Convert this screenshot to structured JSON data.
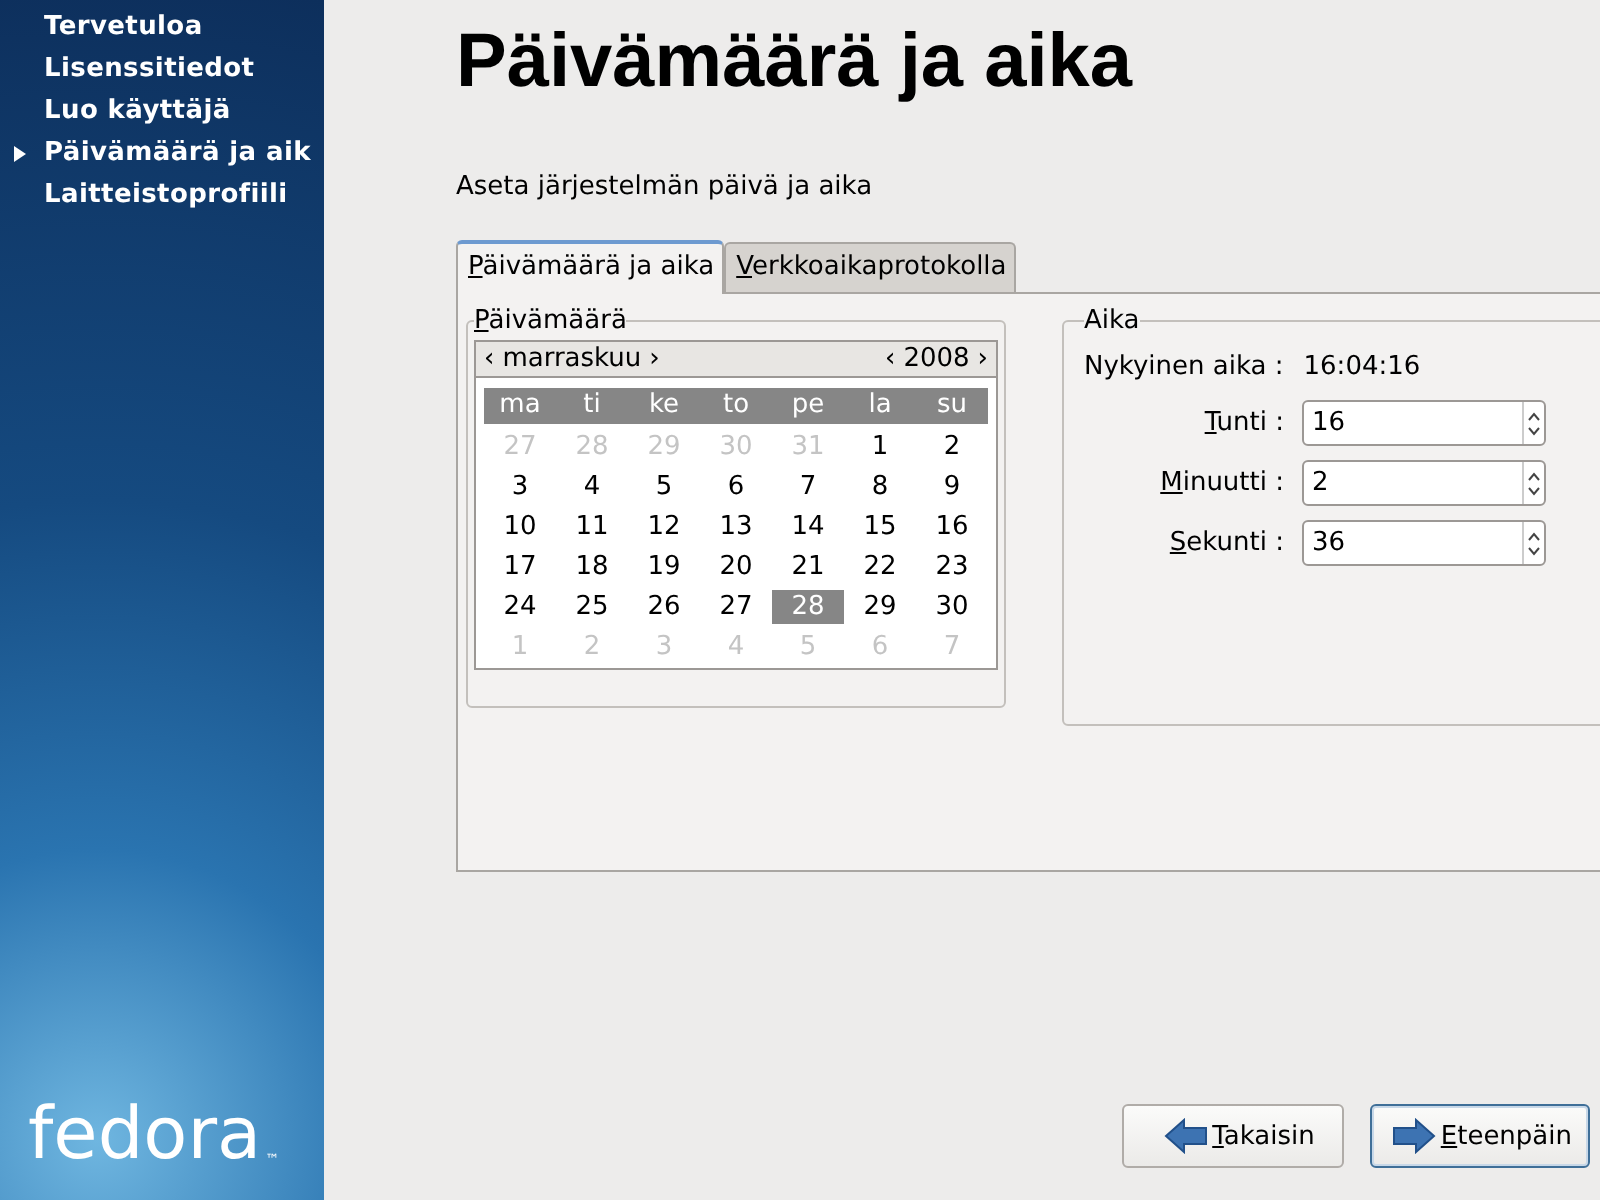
{
  "sidebar": {
    "items": [
      {
        "label": "Tervetuloa",
        "selected": false
      },
      {
        "label": "Lisenssitiedot",
        "selected": false
      },
      {
        "label": "Luo käyttäjä",
        "selected": false
      },
      {
        "label": "Päivämäärä ja aik",
        "selected": true
      },
      {
        "label": "Laitteistoprofiili",
        "selected": false
      }
    ],
    "logo": {
      "text": "fedora",
      "mark": "™"
    }
  },
  "title": "Päivämäärä ja aika",
  "subtitle": "Aseta järjestelmän päivä ja aika",
  "tabs": [
    {
      "label": "Päivämäärä ja aika",
      "selected": true
    },
    {
      "label": "Verkkoaikaprotokolla",
      "selected": false
    }
  ],
  "date": {
    "legend": "Päivämäärä",
    "prev": "‹",
    "next": "›",
    "month": "marraskuu",
    "year": "2008",
    "weekdays": [
      "ma",
      "ti",
      "ke",
      "to",
      "pe",
      "la",
      "su"
    ],
    "weeks": [
      [
        {
          "day": "27",
          "muted": true,
          "selected": false
        },
        {
          "day": "28",
          "muted": true,
          "selected": false
        },
        {
          "day": "29",
          "muted": true,
          "selected": false
        },
        {
          "day": "30",
          "muted": true,
          "selected": false
        },
        {
          "day": "31",
          "muted": true,
          "selected": false
        },
        {
          "day": "1",
          "muted": false,
          "selected": false
        },
        {
          "day": "2",
          "muted": false,
          "selected": false
        }
      ],
      [
        {
          "day": "3",
          "muted": false,
          "selected": false
        },
        {
          "day": "4",
          "muted": false,
          "selected": false
        },
        {
          "day": "5",
          "muted": false,
          "selected": false
        },
        {
          "day": "6",
          "muted": false,
          "selected": false
        },
        {
          "day": "7",
          "muted": false,
          "selected": false
        },
        {
          "day": "8",
          "muted": false,
          "selected": false
        },
        {
          "day": "9",
          "muted": false,
          "selected": false
        }
      ],
      [
        {
          "day": "10",
          "muted": false,
          "selected": false
        },
        {
          "day": "11",
          "muted": false,
          "selected": false
        },
        {
          "day": "12",
          "muted": false,
          "selected": false
        },
        {
          "day": "13",
          "muted": false,
          "selected": false
        },
        {
          "day": "14",
          "muted": false,
          "selected": false
        },
        {
          "day": "15",
          "muted": false,
          "selected": false
        },
        {
          "day": "16",
          "muted": false,
          "selected": false
        }
      ],
      [
        {
          "day": "17",
          "muted": false,
          "selected": false
        },
        {
          "day": "18",
          "muted": false,
          "selected": false
        },
        {
          "day": "19",
          "muted": false,
          "selected": false
        },
        {
          "day": "20",
          "muted": false,
          "selected": false
        },
        {
          "day": "21",
          "muted": false,
          "selected": false
        },
        {
          "day": "22",
          "muted": false,
          "selected": false
        },
        {
          "day": "23",
          "muted": false,
          "selected": false
        }
      ],
      [
        {
          "day": "24",
          "muted": false,
          "selected": false
        },
        {
          "day": "25",
          "muted": false,
          "selected": false
        },
        {
          "day": "26",
          "muted": false,
          "selected": false
        },
        {
          "day": "27",
          "muted": false,
          "selected": false
        },
        {
          "day": "28",
          "muted": false,
          "selected": true
        },
        {
          "day": "29",
          "muted": false,
          "selected": false
        },
        {
          "day": "30",
          "muted": false,
          "selected": false
        }
      ],
      [
        {
          "day": "1",
          "muted": true,
          "selected": false
        },
        {
          "day": "2",
          "muted": true,
          "selected": false
        },
        {
          "day": "3",
          "muted": true,
          "selected": false
        },
        {
          "day": "4",
          "muted": true,
          "selected": false
        },
        {
          "day": "5",
          "muted": true,
          "selected": false
        },
        {
          "day": "6",
          "muted": true,
          "selected": false
        },
        {
          "day": "7",
          "muted": true,
          "selected": false
        }
      ]
    ]
  },
  "time": {
    "legend": "Aika",
    "current_label": "Nykyinen aika :",
    "current_value": "16:04:16",
    "fields": [
      {
        "label": "Tunti :",
        "value": "16"
      },
      {
        "label": "Minuutti :",
        "value": "2"
      },
      {
        "label": "Sekunti :",
        "value": "36"
      }
    ]
  },
  "buttons": [
    {
      "label": "Takaisin",
      "kind": "back",
      "focused": false
    },
    {
      "label": "Eteenpäin",
      "kind": "forward",
      "focused": true
    }
  ]
}
